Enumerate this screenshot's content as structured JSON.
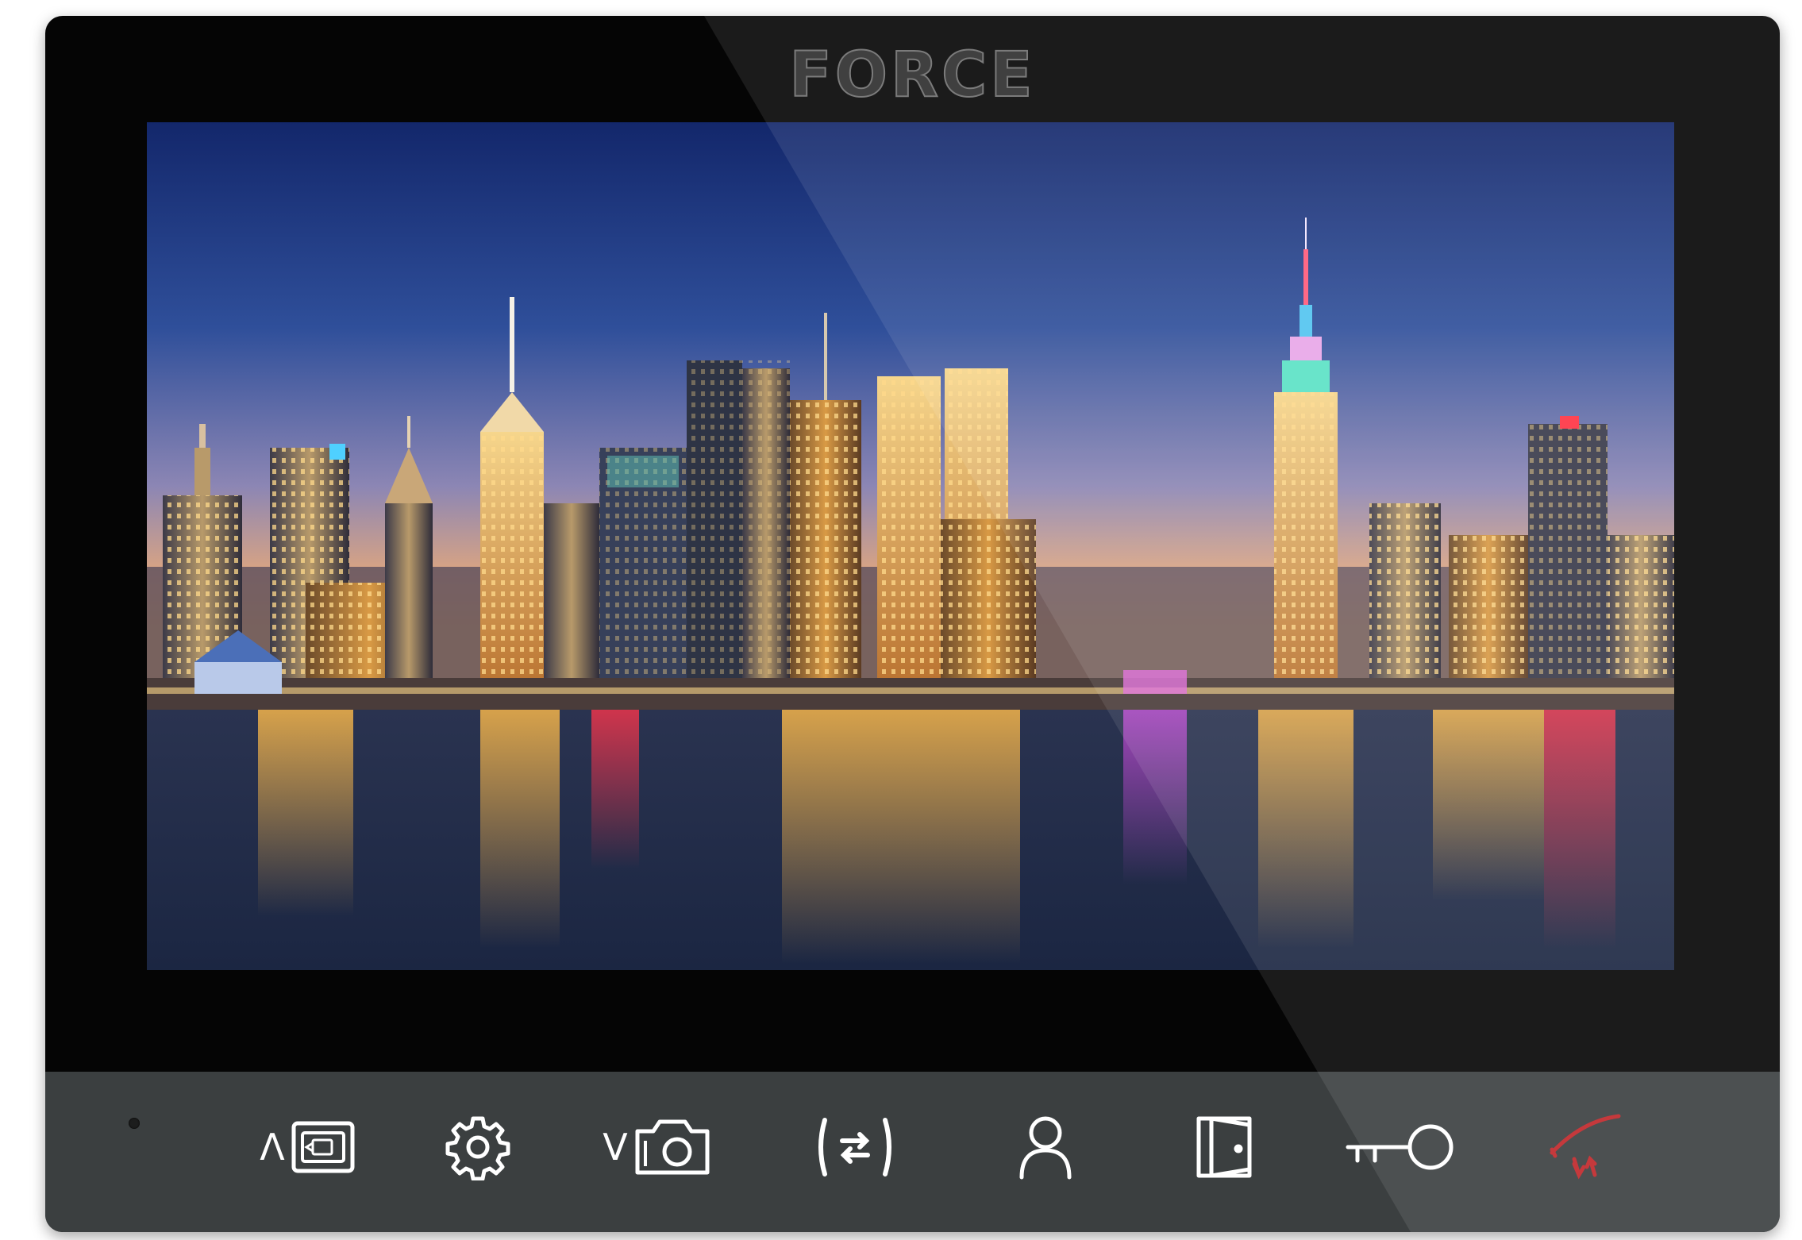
{
  "device": {
    "brand": "FORCE",
    "colors": {
      "bezel": "#050505",
      "control_bar": "#3b3f40",
      "icon": "#ffffff",
      "hangup_icon": "#c5393c"
    }
  },
  "controls": [
    {
      "id": "up_monitor",
      "glyph": "Λ",
      "icon": "monitor-camera-icon"
    },
    {
      "id": "settings",
      "icon": "gear-icon"
    },
    {
      "id": "down_snapshot",
      "glyph": "V",
      "icon": "camera-icon"
    },
    {
      "id": "intercom",
      "icon": "intercom-transfer-icon"
    },
    {
      "id": "user",
      "icon": "user-icon"
    },
    {
      "id": "door",
      "icon": "door-open-icon"
    },
    {
      "id": "unlock",
      "icon": "key-icon"
    },
    {
      "id": "hangup",
      "icon": "handset-hangup-icon"
    }
  ]
}
